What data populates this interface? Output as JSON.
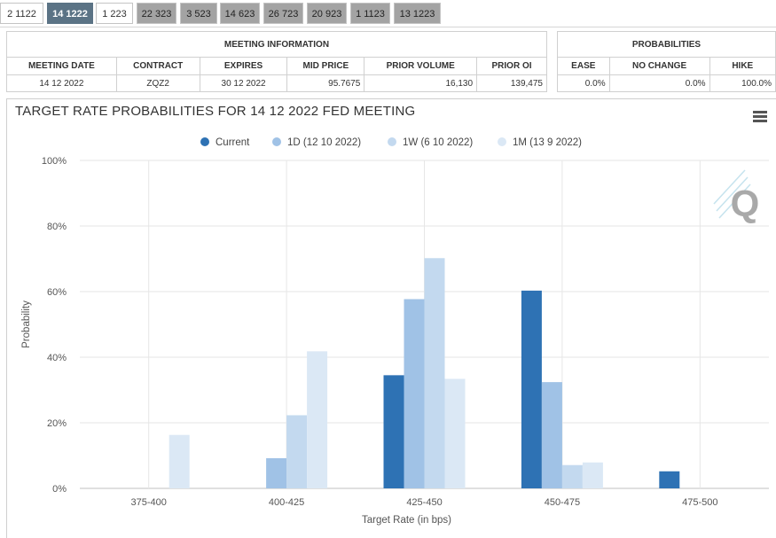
{
  "tabs": [
    {
      "label": "2 1122",
      "state": "white"
    },
    {
      "label": "14 1222",
      "state": "active"
    },
    {
      "label": "1 223",
      "state": "white"
    },
    {
      "label": "22 323",
      "state": "grey"
    },
    {
      "label": "3 523",
      "state": "grey"
    },
    {
      "label": "14 623",
      "state": "grey"
    },
    {
      "label": "26 723",
      "state": "grey"
    },
    {
      "label": "20 923",
      "state": "grey"
    },
    {
      "label": "1 1123",
      "state": "grey"
    },
    {
      "label": "13 1223",
      "state": "grey"
    }
  ],
  "meeting_info": {
    "title": "MEETING INFORMATION",
    "headers": [
      "MEETING DATE",
      "CONTRACT",
      "EXPIRES",
      "MID PRICE",
      "PRIOR VOLUME",
      "PRIOR OI"
    ],
    "values": [
      "14 12 2022",
      "ZQZ2",
      "30 12 2022",
      "95.7675",
      "16,130",
      "139,475"
    ]
  },
  "probabilities": {
    "title": "PROBABILITIES",
    "headers": [
      "EASE",
      "NO CHANGE",
      "HIKE"
    ],
    "values": [
      "0.0%",
      "0.0%",
      "100.0%"
    ]
  },
  "chart_title": "TARGET RATE PROBABILITIES FOR 14 12 2022 FED MEETING",
  "menu_icon": "hamburger-menu-icon",
  "watermark": "Q",
  "chart_data": {
    "type": "bar",
    "xlabel": "Target Rate (in bps)",
    "ylabel": "Probability",
    "categories": [
      "375-400",
      "400-425",
      "425-450",
      "450-475",
      "475-500"
    ],
    "ylim": [
      0,
      100
    ],
    "yticks": [
      "0%",
      "20%",
      "40%",
      "60%",
      "80%",
      "100%"
    ],
    "series": [
      {
        "name": "Current",
        "color": "#2e72b4",
        "values": [
          0,
          0,
          34.5,
          60.3,
          5.2
        ]
      },
      {
        "name": "1D (12 10 2022)",
        "color": "#a0c2e6",
        "values": [
          0,
          9.2,
          57.7,
          32.4,
          0
        ]
      },
      {
        "name": "1W (6 10 2022)",
        "color": "#c3d9ef",
        "values": [
          0,
          22.3,
          70.2,
          7.1,
          0
        ]
      },
      {
        "name": "1M (13 9 2022)",
        "color": "#dbe8f5",
        "values": [
          16.3,
          41.8,
          33.4,
          7.9,
          0
        ]
      }
    ],
    "grid": true,
    "legend": "top-center"
  }
}
